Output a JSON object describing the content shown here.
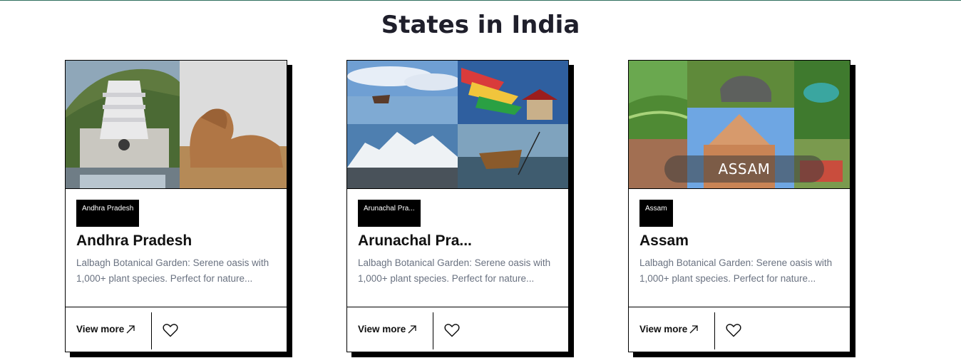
{
  "page": {
    "title": "States in India"
  },
  "cards": [
    {
      "tag": "Andhra Pradesh",
      "title": "Andhra Pradesh",
      "description": "Lalbagh Botanical Garden: Serene oasis with 1,000+ plant species. Perfect for nature...",
      "view_more": "View more"
    },
    {
      "tag": "Arunachal Pra...",
      "title": "Arunachal Pra...",
      "description": "Lalbagh Botanical Garden: Serene oasis with 1,000+ plant species. Perfect for nature...",
      "view_more": "View more"
    },
    {
      "tag": "Assam",
      "title": "Assam",
      "image_caption": "ASSAM",
      "description": "Lalbagh Botanical Garden: Serene oasis with 1,000+ plant species. Perfect for nature...",
      "view_more": "View more"
    }
  ],
  "icons": {
    "view_more": "arrow-up-right-icon",
    "favorite": "heart-icon"
  },
  "colors": {
    "accent_border": "#2f6f5e",
    "text": "#1f1f2b",
    "muted": "#6a7281"
  }
}
